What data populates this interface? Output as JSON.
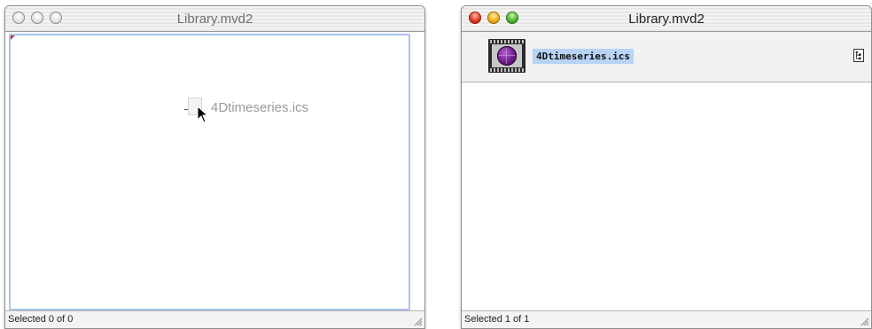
{
  "windows": {
    "left": {
      "title": "Library.mvd2",
      "dragged_file": "4Dtimeseries.ics",
      "status": "Selected 0 of 0"
    },
    "right": {
      "title": "Library.mvd2",
      "selected_file": "4Dtimeseries.ics",
      "status": "Selected 1 of 1"
    }
  },
  "icons": [
    "close-icon",
    "minimize-icon",
    "zoom-icon",
    "document-icon",
    "mouse-cursor-icon",
    "movie-thumbnail-icon",
    "hierarchy-icon",
    "resize-grip-icon"
  ],
  "colors": {
    "selection": "#b7d3f6",
    "drop_highlight": "#aac6ee"
  }
}
